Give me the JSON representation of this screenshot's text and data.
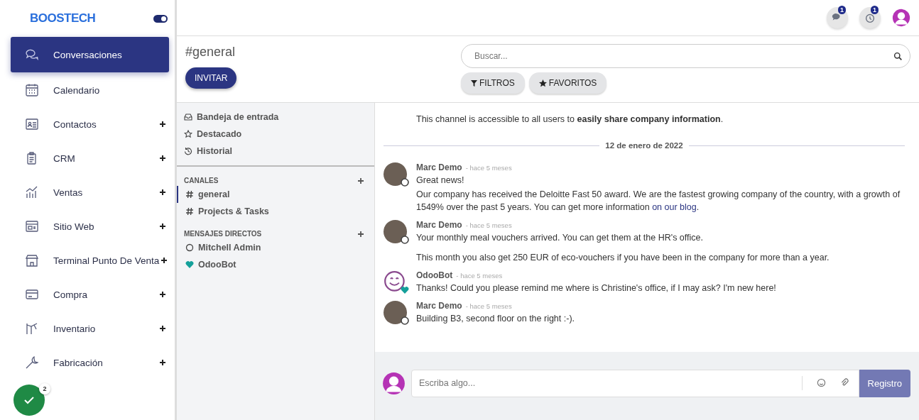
{
  "brand": {
    "name": "BOOSTECH",
    "toggle_on": true
  },
  "apps": [
    {
      "label": "Conversaciones",
      "selected": true,
      "expandable": false
    },
    {
      "label": "Calendario",
      "selected": false,
      "expandable": false
    },
    {
      "label": "Contactos",
      "selected": false,
      "expandable": true
    },
    {
      "label": "CRM",
      "selected": false,
      "expandable": true
    },
    {
      "label": "Ventas",
      "selected": false,
      "expandable": true
    },
    {
      "label": "Sitio Web",
      "selected": false,
      "expandable": true
    },
    {
      "label": "Terminal Punto De Venta",
      "selected": false,
      "expandable": true
    },
    {
      "label": "Compra",
      "selected": false,
      "expandable": true
    },
    {
      "label": "Inventario",
      "selected": false,
      "expandable": true
    },
    {
      "label": "Fabricación",
      "selected": false,
      "expandable": true
    }
  ],
  "topbar": {
    "chat_badge": "1",
    "activity_badge": "1"
  },
  "control": {
    "title": "#general",
    "invite": "INVITAR",
    "search": {
      "placeholder": "Buscar..."
    },
    "filters": "FILTROS",
    "favorites": "FAVORITOS"
  },
  "mailboxes": [
    {
      "label": "Bandeja de entrada",
      "kind": "inbox"
    },
    {
      "label": "Destacado",
      "kind": "starred"
    },
    {
      "label": "Historial",
      "kind": "history"
    }
  ],
  "channels_heading": "CANALES",
  "channels": [
    {
      "name": "general",
      "selected": true
    },
    {
      "name": "Projects & Tasks",
      "selected": false
    }
  ],
  "direct_heading": "MENSAJES DIRECTOS",
  "direct": [
    {
      "name": "Mitchell Admin",
      "kind": "offline"
    },
    {
      "name": "OdooBot",
      "kind": "bot"
    }
  ],
  "intro": "This channel is accessible to all users to **easily share company information**.",
  "date_separator": "12 de enero de 2022",
  "messages": [
    {
      "author": "Marc Demo",
      "time": "- hace 5 meses",
      "kind": "person",
      "paragraphs": [
        [
          [
            {
              "text": "Great news!",
              "kind": "plain"
            }
          ],
          [
            {
              "text": "Our company has received the Deloitte Fast 50 award. We are the fastest growing company of the country, with a growth of 1549% over the past 5 years. You can get more information ",
              "kind": "plain"
            },
            {
              "text": "on our blog",
              "kind": "link"
            },
            {
              "text": ".",
              "kind": "plain"
            }
          ]
        ]
      ]
    },
    {
      "author": "Marc Demo",
      "time": "- hace 5 meses",
      "kind": "person",
      "paragraphs": [
        [
          [
            {
              "text": "Your monthly meal vouchers arrived. You can get them at the HR's office.",
              "kind": "plain"
            }
          ]
        ],
        [
          [
            {
              "text": "This month you also get 250 EUR of eco-vouchers if you have been in the company for more than a year.",
              "kind": "plain"
            }
          ]
        ]
      ]
    },
    {
      "author": "OdooBot",
      "time": "- hace 5 meses",
      "kind": "bot",
      "paragraphs": [
        [
          [
            {
              "text": "Thanks! Could you please remind me where is Christine's office, if I may ask? I'm new here!",
              "kind": "plain"
            }
          ]
        ]
      ]
    },
    {
      "author": "Marc Demo",
      "time": "- hace 5 meses",
      "kind": "person",
      "paragraphs": [
        [
          [
            {
              "text": "Building B3, second floor on the right :-).",
              "kind": "plain"
            }
          ]
        ]
      ]
    }
  ],
  "composer": {
    "placeholder": "Escriba algo...",
    "send": "Registro"
  },
  "floating_badge": "2"
}
